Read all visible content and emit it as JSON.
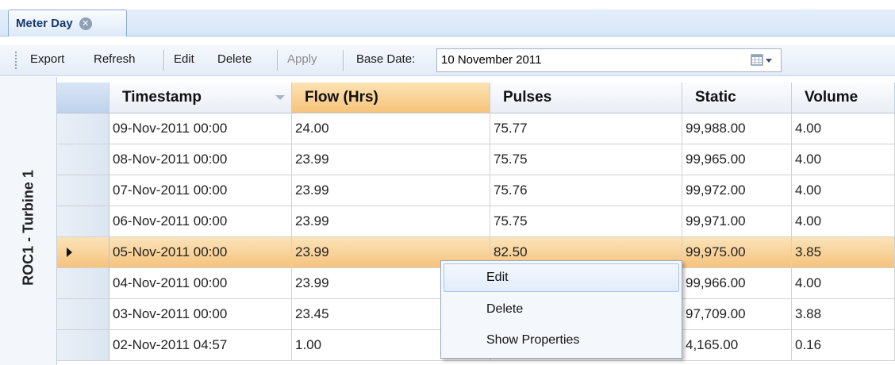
{
  "tab": {
    "title": "Meter Day",
    "close_icon": "close-icon"
  },
  "toolbar": {
    "export": "Export",
    "refresh": "Refresh",
    "edit": "Edit",
    "delete": "Delete",
    "apply": "Apply",
    "base_date_label": "Base Date:",
    "base_date_value": "10 November 2011",
    "calendar_icon": "calendar-icon"
  },
  "side_label": "ROC1 - Turbine 1",
  "grid": {
    "columns": [
      "Timestamp",
      "Flow (Hrs)",
      "Pulses",
      "Static",
      "Volume"
    ],
    "selected_column": "Flow (Hrs)",
    "current_row_index": 4,
    "rows": [
      [
        "09-Nov-2011 00:00",
        "24.00",
        "75.77",
        "99,988.00",
        "4.00"
      ],
      [
        "08-Nov-2011 00:00",
        "23.99",
        "75.75",
        "99,965.00",
        "4.00"
      ],
      [
        "07-Nov-2011 00:00",
        "23.99",
        "75.76",
        "99,972.00",
        "4.00"
      ],
      [
        "06-Nov-2011 00:00",
        "23.99",
        "75.75",
        "99,971.00",
        "4.00"
      ],
      [
        "05-Nov-2011 00:00",
        "23.99",
        "82.50",
        "99,975.00",
        "3.85"
      ],
      [
        "04-Nov-2011 00:00",
        "23.99",
        "",
        "99,966.00",
        "4.00"
      ],
      [
        "03-Nov-2011 00:00",
        "23.45",
        "",
        "97,709.00",
        "3.88"
      ],
      [
        "02-Nov-2011 04:57",
        "1.00",
        "",
        "4,165.00",
        "0.16"
      ]
    ]
  },
  "context_menu": {
    "items": [
      "Edit",
      "Delete",
      "Show Properties"
    ],
    "hovered": "Edit"
  },
  "colors": {
    "selection": "#f6c37a",
    "tab_border": "#8ea9cf",
    "header_bg": "#e9eef5"
  }
}
